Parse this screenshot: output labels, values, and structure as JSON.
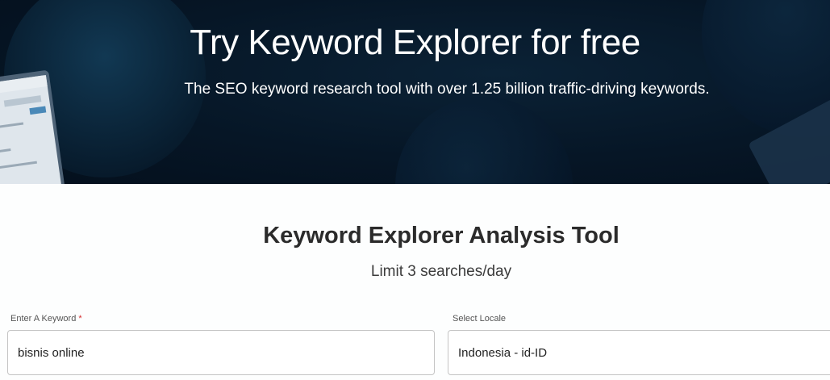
{
  "hero": {
    "title": "Try Keyword Explorer for free",
    "subtitle": "The SEO keyword research tool with over 1.25 billion traffic-driving keywords."
  },
  "tool": {
    "title": "Keyword Explorer Analysis Tool",
    "limit_text": "Limit 3 searches/day"
  },
  "form": {
    "keyword": {
      "label": "Enter A Keyword",
      "required_mark": "*",
      "value": "bisnis online"
    },
    "locale": {
      "label": "Select Locale",
      "value": "Indonesia - id-ID"
    }
  },
  "colors": {
    "hero_bg": "#061626",
    "page_bg": "#fdfefe",
    "required": "#d63031"
  }
}
